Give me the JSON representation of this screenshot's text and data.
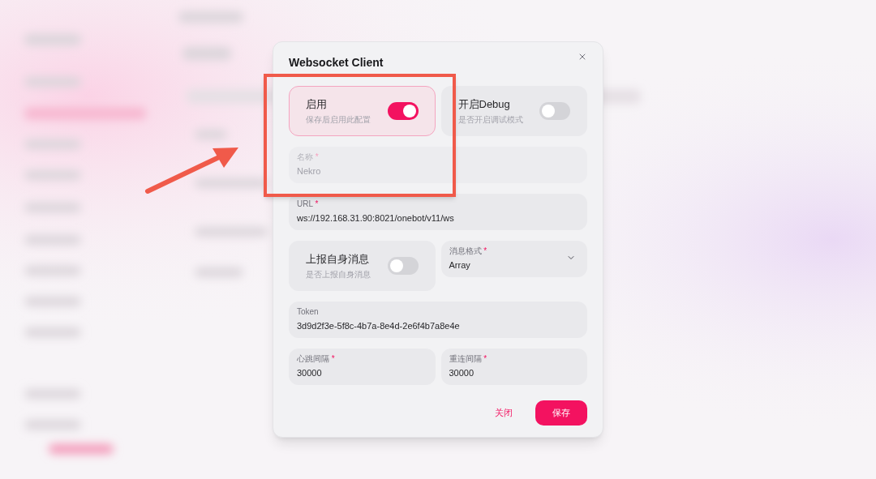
{
  "dialog": {
    "title": "Websocket Client",
    "fields": [
      {
        "kind": "switch",
        "label": "启用",
        "hint": "保存后启用此配置",
        "on": true,
        "wide": false
      },
      {
        "kind": "switch",
        "label": "开启Debug",
        "hint": "是否开启调试模式",
        "on": false,
        "wide": false
      },
      {
        "kind": "input",
        "label": "名称",
        "required_mark": "*",
        "value": "Nekro",
        "disabled": true,
        "wide": true
      },
      {
        "kind": "input",
        "label": "URL",
        "required_mark": "*",
        "value": "ws://192.168.31.90:8021/onebot/v11/ws",
        "disabled": false,
        "wide": true
      },
      {
        "kind": "switch",
        "label": "上报自身消息",
        "hint": "是否上报自身消息",
        "on": false,
        "wide": false
      },
      {
        "kind": "select",
        "label": "消息格式",
        "required_mark": "*",
        "value": "Array",
        "wide": false
      },
      {
        "kind": "input",
        "label": "Token",
        "value": "3d9d2f3e-5f8c-4b7a-8e4d-2e6f4b7a8e4e",
        "disabled": false,
        "wide": true
      },
      {
        "kind": "input",
        "label": "心跳间隔",
        "required_mark": "*",
        "value": "30000",
        "disabled": false,
        "wide": false
      },
      {
        "kind": "input",
        "label": "重连间隔",
        "required_mark": "*",
        "value": "30000",
        "disabled": false,
        "wide": false
      }
    ],
    "buttons": [
      {
        "label": "关闭",
        "kind": "text"
      },
      {
        "label": "保存",
        "kind": "primary"
      }
    ]
  }
}
